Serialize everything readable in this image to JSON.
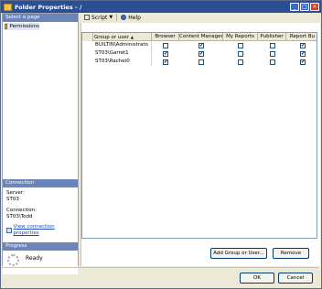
{
  "window": {
    "title": "Folder Properties - /"
  },
  "left": {
    "select_header": "Select a page",
    "pages": [
      {
        "label": "Permissions"
      }
    ],
    "connection_header": "Connection",
    "server_label": "Server:",
    "server_value": "ST03",
    "connection_label": "Connection:",
    "connection_value": "ST03\\Todd",
    "view_link": "View connection properties",
    "progress_header": "Progress",
    "progress_status": "Ready"
  },
  "toolbar": {
    "script_label": "Script",
    "help_label": "Help"
  },
  "grid": {
    "columns": [
      "Group or user",
      "Browser",
      "Content Manager",
      "My Reports",
      "Publisher",
      "Report Bu"
    ],
    "rows": [
      {
        "name": "BUILTIN\\Administrato",
        "checks": [
          false,
          true,
          false,
          false,
          true
        ]
      },
      {
        "name": "ST03\\Garret1",
        "checks": [
          true,
          true,
          false,
          false,
          true
        ]
      },
      {
        "name": "ST03\\Rachel0",
        "checks": [
          true,
          false,
          false,
          false,
          true
        ]
      }
    ]
  },
  "buttons": {
    "add": "Add Group or User...",
    "remove": "Remove",
    "ok": "OK",
    "cancel": "Cancel"
  }
}
